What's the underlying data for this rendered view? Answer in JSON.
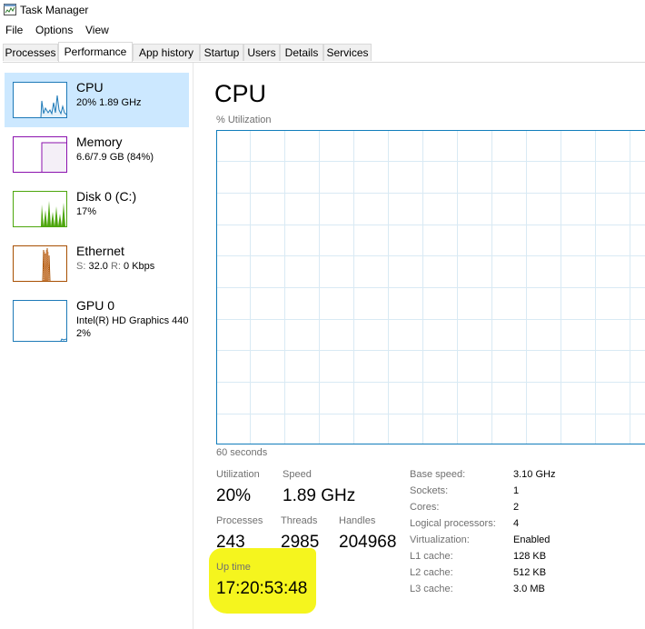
{
  "window": {
    "title": "Task Manager"
  },
  "menu": [
    "File",
    "Options",
    "View"
  ],
  "tabs": [
    "Processes",
    "Performance",
    "App history",
    "Startup",
    "Users",
    "Details",
    "Services"
  ],
  "active_tab": "Performance",
  "sidebar": {
    "items": [
      {
        "name": "CPU",
        "line1": "20% 1.89 GHz",
        "color": "#1e7ab8",
        "active": true
      },
      {
        "name": "Memory",
        "line1": "6.6/7.9 GB (84%)",
        "color": "#8b12ae"
      },
      {
        "name": "Disk 0 (C:)",
        "line1": "17%",
        "color": "#4da60c"
      },
      {
        "name": "Ethernet",
        "line1_label_s": "S:",
        "line1_val_s": "32.0",
        "line1_label_r": "R:",
        "line1_val_r": "0 Kbps",
        "color": "#a74f01"
      },
      {
        "name": "GPU 0",
        "line1": "Intel(R) HD Graphics 440",
        "line2": "2%",
        "color": "#1e7ab8"
      }
    ]
  },
  "main": {
    "title": "CPU",
    "graph_label": "% Utilization",
    "time_label": "60 seconds",
    "stats": {
      "utilization_label": "Utilization",
      "utilization": "20%",
      "speed_label": "Speed",
      "speed": "1.89 GHz",
      "processes_label": "Processes",
      "processes": "243",
      "threads_label": "Threads",
      "threads": "2985",
      "handles_label": "Handles",
      "handles": "204968",
      "uptime_label": "Up time",
      "uptime": "17:20:53:48"
    },
    "info": [
      {
        "label": "Base speed:",
        "value": "3.10 GHz"
      },
      {
        "label": "Sockets:",
        "value": "1"
      },
      {
        "label": "Cores:",
        "value": "2"
      },
      {
        "label": "Logical processors:",
        "value": "4"
      },
      {
        "label": "Virtualization:",
        "value": "Enabled"
      },
      {
        "label": "L1 cache:",
        "value": "128 KB"
      },
      {
        "label": "L2 cache:",
        "value": "512 KB"
      },
      {
        "label": "L3 cache:",
        "value": "3.0 MB"
      }
    ]
  },
  "colors": {
    "accent_bg": "#cce8ff",
    "graph_border": "#117dbb",
    "graph_grid": "#d9eaf4",
    "highlight": "#f5f51e"
  }
}
